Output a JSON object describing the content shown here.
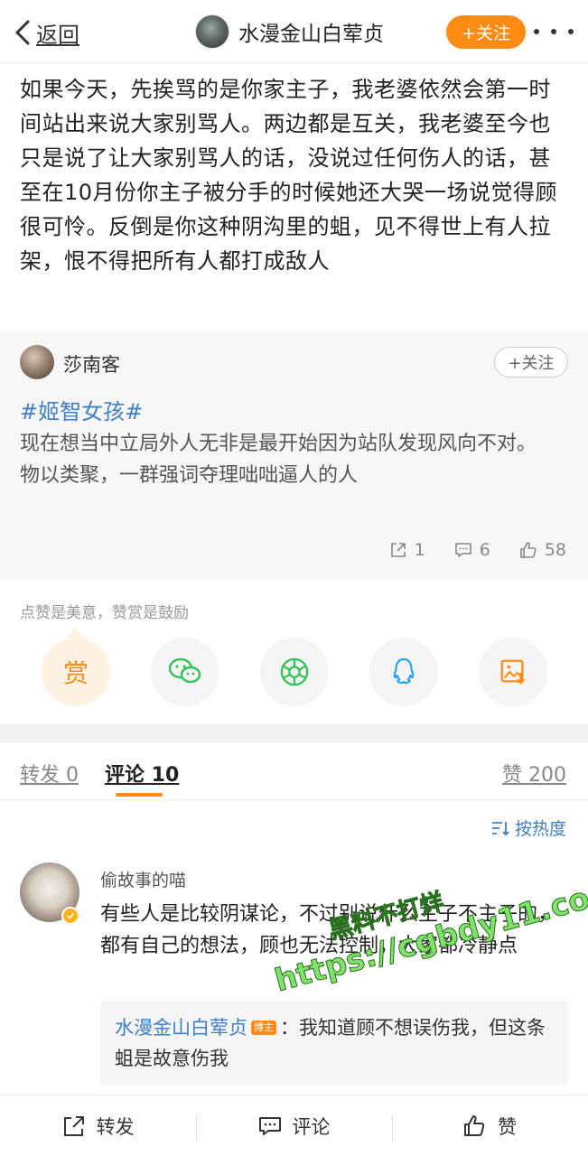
{
  "header": {
    "back_label": "返回",
    "username": "水漫金山白荤贞",
    "follow_label": "+关注"
  },
  "post": {
    "text": "如果今天，先挨骂的是你家主子，我老婆依然会第一时间站出来说大家别骂人。两边都是互关，我老婆至今也只是说了让大家别骂人的话，没说过任何伤人的话，甚至在10月份你主子被分手的时候她还大哭一场说觉得顾很可怜。反倒是你这种阴沟里的蛆，见不得世上有人拉架，恨不得把所有人都打成敌人"
  },
  "repost": {
    "author": "莎南客",
    "follow_label": "+关注",
    "hashtag": "#姬智女孩#",
    "line1": "现在想当中立局外人无非是最开始因为站队发现风向不对。",
    "line2": "物以类聚，一群强词夺理咄咄逼人的人",
    "shares": "1",
    "comments": "6",
    "likes": "58"
  },
  "reward": {
    "hint": "点赞是美意，赞赏是鼓励",
    "reward_glyph": "赏",
    "share_targets": [
      "wechat-icon",
      "moments-icon",
      "qq-icon",
      "save-image-icon"
    ]
  },
  "tabs": {
    "repost": "转发 0",
    "comment": "评论 10",
    "like": "赞 200"
  },
  "sort_label": "按热度",
  "comment": {
    "author": "偷故事的喵",
    "text": "有些人是比较阴谋论，不过别说什么主子不主子的，都有自己的想法，顾也无法控制，大家都冷静点",
    "reply_author": "水漫金山白荤贞",
    "reply_badge": "博主",
    "reply_text": "：我知道顾不想误伤我，但这条蛆是故意伤我"
  },
  "watermark": {
    "line1": "黑料不打烊",
    "line2": "https://cgbdy11.com"
  },
  "bottom_bar": {
    "repost": "转发",
    "comment": "评论",
    "like": "赞"
  },
  "colors": {
    "accent": "#ff8a14",
    "link": "#3e7fc7",
    "wechat": "#35c15a",
    "qq": "#1da1f2"
  }
}
